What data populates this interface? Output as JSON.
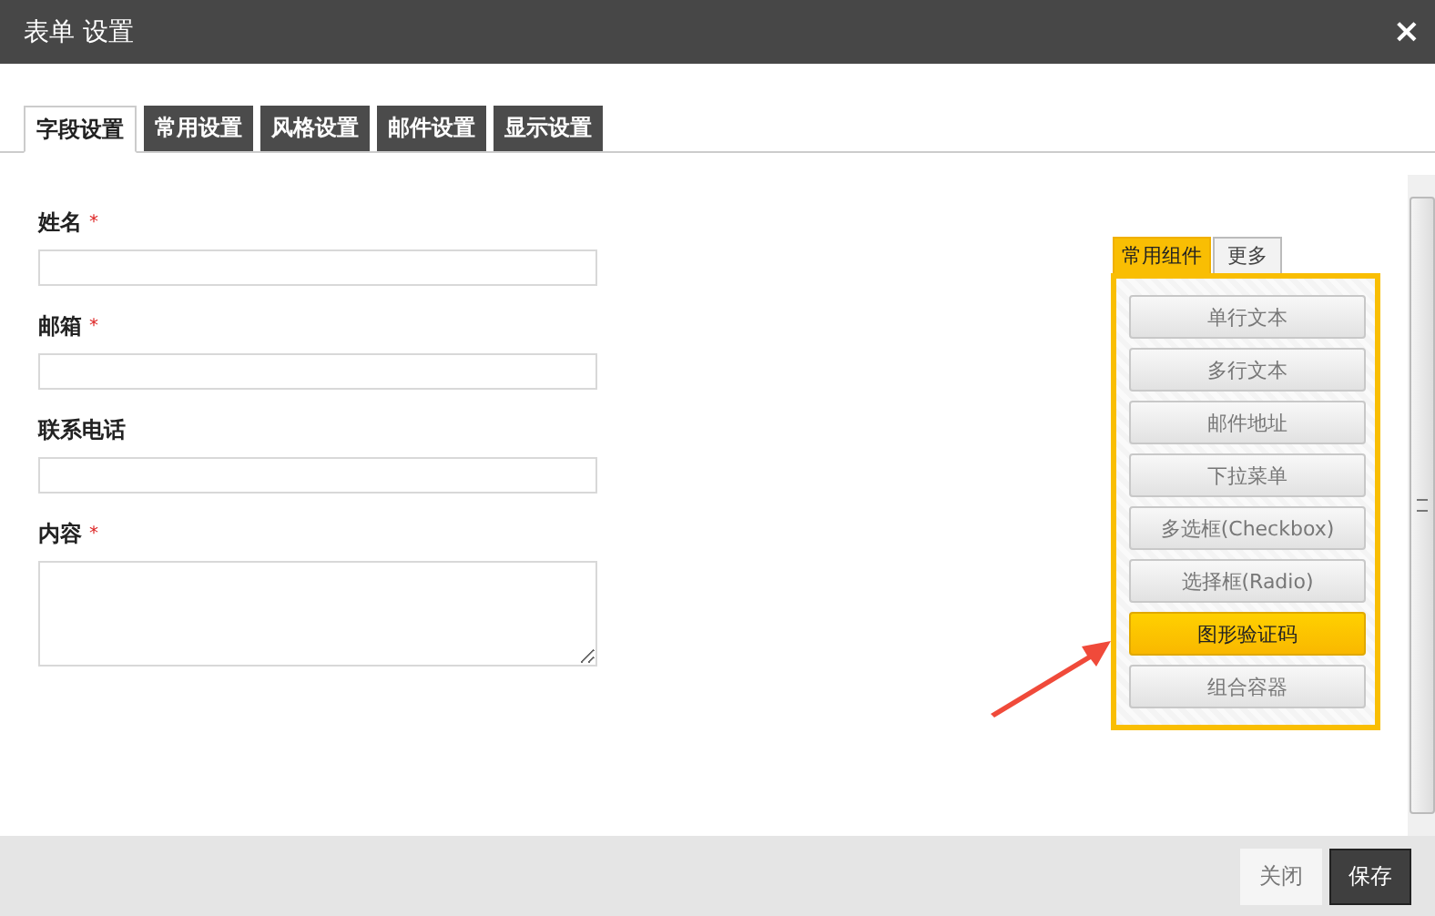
{
  "window": {
    "title": "表单 设置",
    "close": "×"
  },
  "tabs": [
    {
      "label": "字段设置",
      "selected": true
    },
    {
      "label": "常用设置",
      "selected": false
    },
    {
      "label": "风格设置",
      "selected": false
    },
    {
      "label": "邮件设置",
      "selected": false
    },
    {
      "label": "显示设置",
      "selected": false
    }
  ],
  "required_mark": "*",
  "fields": [
    {
      "label": "姓名",
      "required": true,
      "kind": "input"
    },
    {
      "label": "邮箱",
      "required": true,
      "kind": "input"
    },
    {
      "label": "联系电话",
      "required": false,
      "kind": "input"
    },
    {
      "label": "内容",
      "required": true,
      "kind": "textarea"
    }
  ],
  "palette": {
    "tabs": [
      {
        "label": "常用组件",
        "selected": true
      },
      {
        "label": "更多",
        "selected": false
      }
    ],
    "items": [
      {
        "label": "单行文本",
        "selected": false
      },
      {
        "label": "多行文本",
        "selected": false
      },
      {
        "label": "邮件地址",
        "selected": false
      },
      {
        "label": "下拉菜单",
        "selected": false
      },
      {
        "label": "多选框(Checkbox)",
        "selected": false
      },
      {
        "label": "选择框(Radio)",
        "selected": false
      },
      {
        "label": "图形验证码",
        "selected": true
      },
      {
        "label": "组合容器",
        "selected": false
      }
    ]
  },
  "buttons": [
    {
      "label": "关闭",
      "kind": "secondary"
    },
    {
      "label": "保存",
      "kind": "primary"
    }
  ]
}
